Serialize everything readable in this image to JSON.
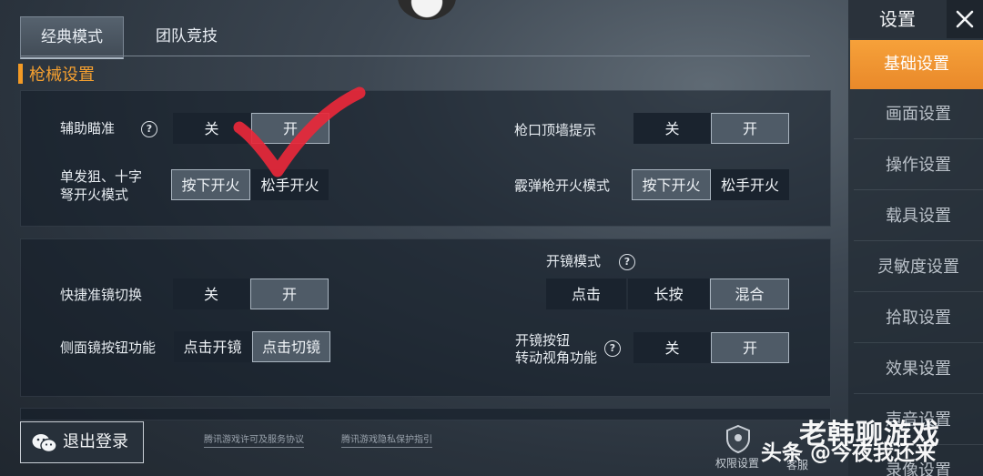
{
  "tabs": {
    "classic": "经典模式",
    "team": "团队竞技"
  },
  "section_title": "枪械设置",
  "panel1": {
    "aim_assist": {
      "label": "辅助瞄准",
      "off": "关",
      "on": "开"
    },
    "muzzle_wall": {
      "label": "枪口顶墙提示",
      "off": "关",
      "on": "开"
    },
    "single_fire": {
      "label_line1": "单发狙、十字",
      "label_line2": "弩开火模式",
      "press": "按下开火",
      "release": "松手开火"
    },
    "shotgun_fire": {
      "label": "霰弹枪开火模式",
      "press": "按下开火",
      "release": "松手开火"
    }
  },
  "panel2": {
    "scope_mode": {
      "label": "开镜模式",
      "tap": "点击",
      "hold": "长按",
      "mixed": "混合"
    },
    "quick_scope": {
      "label": "快捷准镜切换",
      "off": "关",
      "on": "开"
    },
    "side_scope": {
      "label": "侧面镜按钮功能",
      "open": "点击开镜",
      "switch": "点击切镜"
    },
    "scope_turn": {
      "label_line1": "开镜按钮",
      "label_line2": "转动视角功能",
      "off": "关",
      "on": "开"
    }
  },
  "sidebar": {
    "title": "设置",
    "items": [
      "基础设置",
      "画面设置",
      "操作设置",
      "载具设置",
      "灵敏度设置",
      "拾取设置",
      "效果设置",
      "声音设置",
      "录像设置"
    ]
  },
  "bottom": {
    "logout": "退出登录",
    "license_link": "腾讯游戏许可及服务协议",
    "privacy_link": "腾讯游戏隐私保护指引",
    "permission_label": "权限设置",
    "service_label": "客服"
  },
  "watermark": {
    "line1": "老韩聊游戏",
    "line2": "头条 @今夜我还来"
  },
  "colors": {
    "accent": "#f39a25",
    "toggle_on": "#4f5b67",
    "toggle_off": "#1a232e",
    "check_red": "#e8283a"
  },
  "icons": {
    "help": "question-circle-icon",
    "close": "close-icon",
    "wechat": "wechat-icon",
    "check": "red-check-mark-icon"
  }
}
